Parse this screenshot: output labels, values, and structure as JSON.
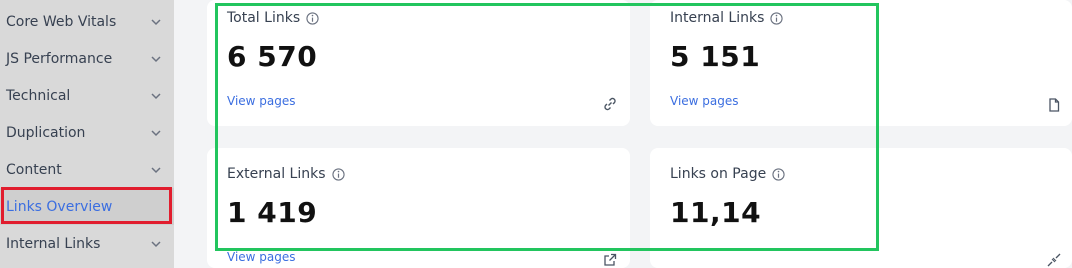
{
  "sidebar": {
    "items": [
      {
        "label": "Core Web Vitals"
      },
      {
        "label": "JS Performance"
      },
      {
        "label": "Technical"
      },
      {
        "label": "Duplication"
      },
      {
        "label": "Content"
      },
      {
        "label": "Links Overview"
      },
      {
        "label": "Internal Links"
      }
    ],
    "active": "Links Overview"
  },
  "cards": [
    {
      "title": "Total Links",
      "value": "6 570",
      "link": "View pages",
      "icon": "link-icon"
    },
    {
      "title": "Internal Links",
      "value": "5 151",
      "link": "View pages",
      "icon": "document-icon"
    },
    {
      "title": "External Links",
      "value": "1 419",
      "link": "View pages",
      "icon": "external-link-icon"
    },
    {
      "title": "Links on Page",
      "value": "11,14",
      "link": "",
      "icon": "broken-link-icon"
    }
  ],
  "colors": {
    "accent": "#3b6ee0",
    "highlight_green": "#22c55e",
    "highlight_red": "#e11d2e"
  }
}
